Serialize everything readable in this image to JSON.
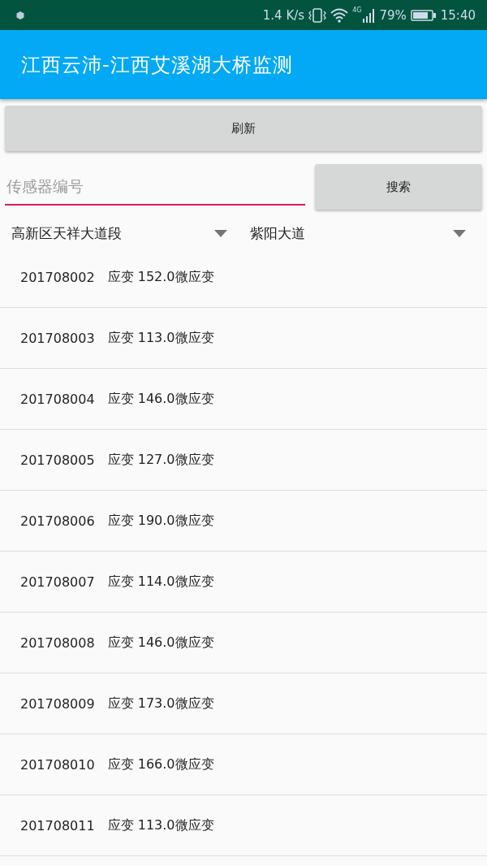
{
  "status_bar": {
    "speed": "1.4 K/s",
    "network": "4G",
    "battery": "79%",
    "time": "15:40"
  },
  "app_bar": {
    "title": "江西云沛-江西艾溪湖大桥监测"
  },
  "refresh_button": {
    "label": "刷新"
  },
  "search": {
    "placeholder": "传感器编号",
    "button": "搜索"
  },
  "spinners": [
    {
      "value": "高新区天祥大道段"
    },
    {
      "value": "紫阳大道"
    }
  ],
  "rows": [
    {
      "id": "201708002",
      "reading": "应变 152.0微应变"
    },
    {
      "id": "201708003",
      "reading": "应变 113.0微应变"
    },
    {
      "id": "201708004",
      "reading": "应变 146.0微应变"
    },
    {
      "id": "201708005",
      "reading": "应变 127.0微应变"
    },
    {
      "id": "201708006",
      "reading": "应变 190.0微应变"
    },
    {
      "id": "201708007",
      "reading": "应变 114.0微应变"
    },
    {
      "id": "201708008",
      "reading": "应变 146.0微应变"
    },
    {
      "id": "201708009",
      "reading": "应变 173.0微应变"
    },
    {
      "id": "201708010",
      "reading": "应变 166.0微应变"
    },
    {
      "id": "201708011",
      "reading": "应变 113.0微应变"
    }
  ]
}
